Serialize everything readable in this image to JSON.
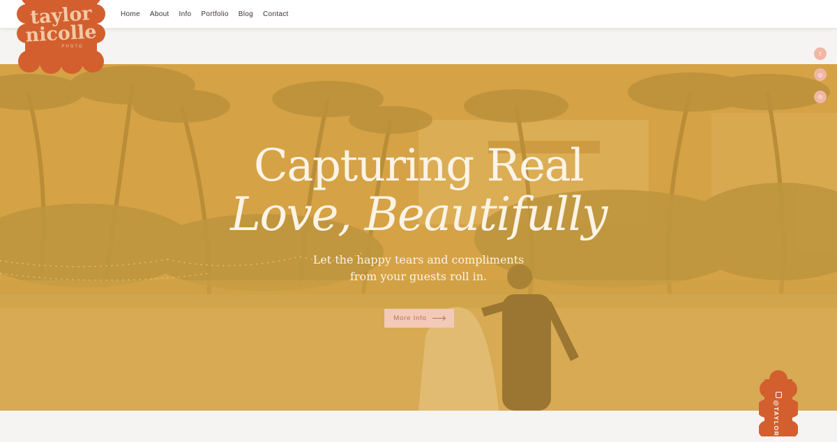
{
  "logo": {
    "line1": "taylor",
    "line2": "nicolle",
    "line3": "PHOTO",
    "color": "#d35f2f"
  },
  "nav": {
    "items": [
      "Home",
      "About",
      "Info",
      "Portfolio",
      "Blog",
      "Contact"
    ]
  },
  "hero": {
    "headline_line1": "Capturing Real",
    "headline_line2": "Love, Beautifully",
    "subtext_line1": "Let the happy tears and compliments",
    "subtext_line2": "from your guests roll in.",
    "cta_label": "More Info",
    "overlay_color": "#dea842"
  },
  "social": {
    "icons": [
      "facebook-icon",
      "instagram-icon",
      "pinterest-icon"
    ],
    "glyphs": [
      "f",
      "◎",
      "℗"
    ]
  },
  "instagram_tab": {
    "label": "@TAYLORN"
  },
  "colors": {
    "accent": "#d35f2f",
    "button": "#f3c9b8",
    "social": "#f0b7a5",
    "text_light": "#fbf3e6"
  }
}
